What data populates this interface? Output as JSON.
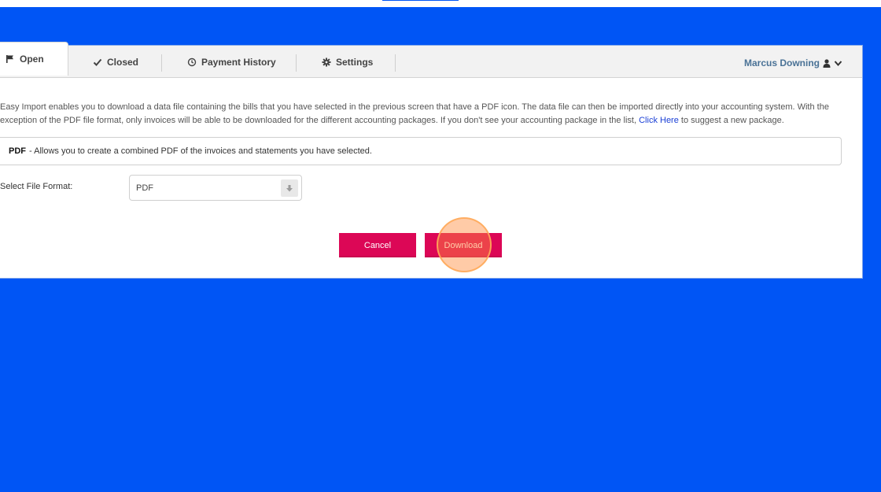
{
  "tabs": [
    {
      "label": "Open",
      "icon": "flag-icon"
    },
    {
      "label": "Closed",
      "icon": "check-icon"
    },
    {
      "label": "Payment History",
      "icon": "clock-icon"
    },
    {
      "label": "Settings",
      "icon": "gear-icon"
    }
  ],
  "user": {
    "name": "Marcus Downing",
    "icons": [
      "user-icon",
      "chevron-down-icon"
    ]
  },
  "intro": {
    "text_before": "Easy Import enables you to download a data file containing the bills that you have selected in the previous screen that have a PDF icon. The data file can then be imported directly into your accounting system. With the exception of the PDF file format, only invoices will be able to be downloaded for the different accounting packages. If you don't see your accounting package in the list, ",
    "link": "Click Here",
    "text_after": " to suggest a new package."
  },
  "info": {
    "format_name": "PDF",
    "description": "- Allows you to create a combined PDF of the invoices and statements you have selected."
  },
  "file_format": {
    "label": "Select File Format:",
    "selected": "PDF"
  },
  "buttons": {
    "cancel": "Cancel",
    "download": "Download"
  },
  "colors": {
    "background": "#0055f5",
    "button": "#dc0756",
    "user_name": "#4a7296",
    "link": "#1a3fd6",
    "click_highlight": "#ff8c3c"
  }
}
